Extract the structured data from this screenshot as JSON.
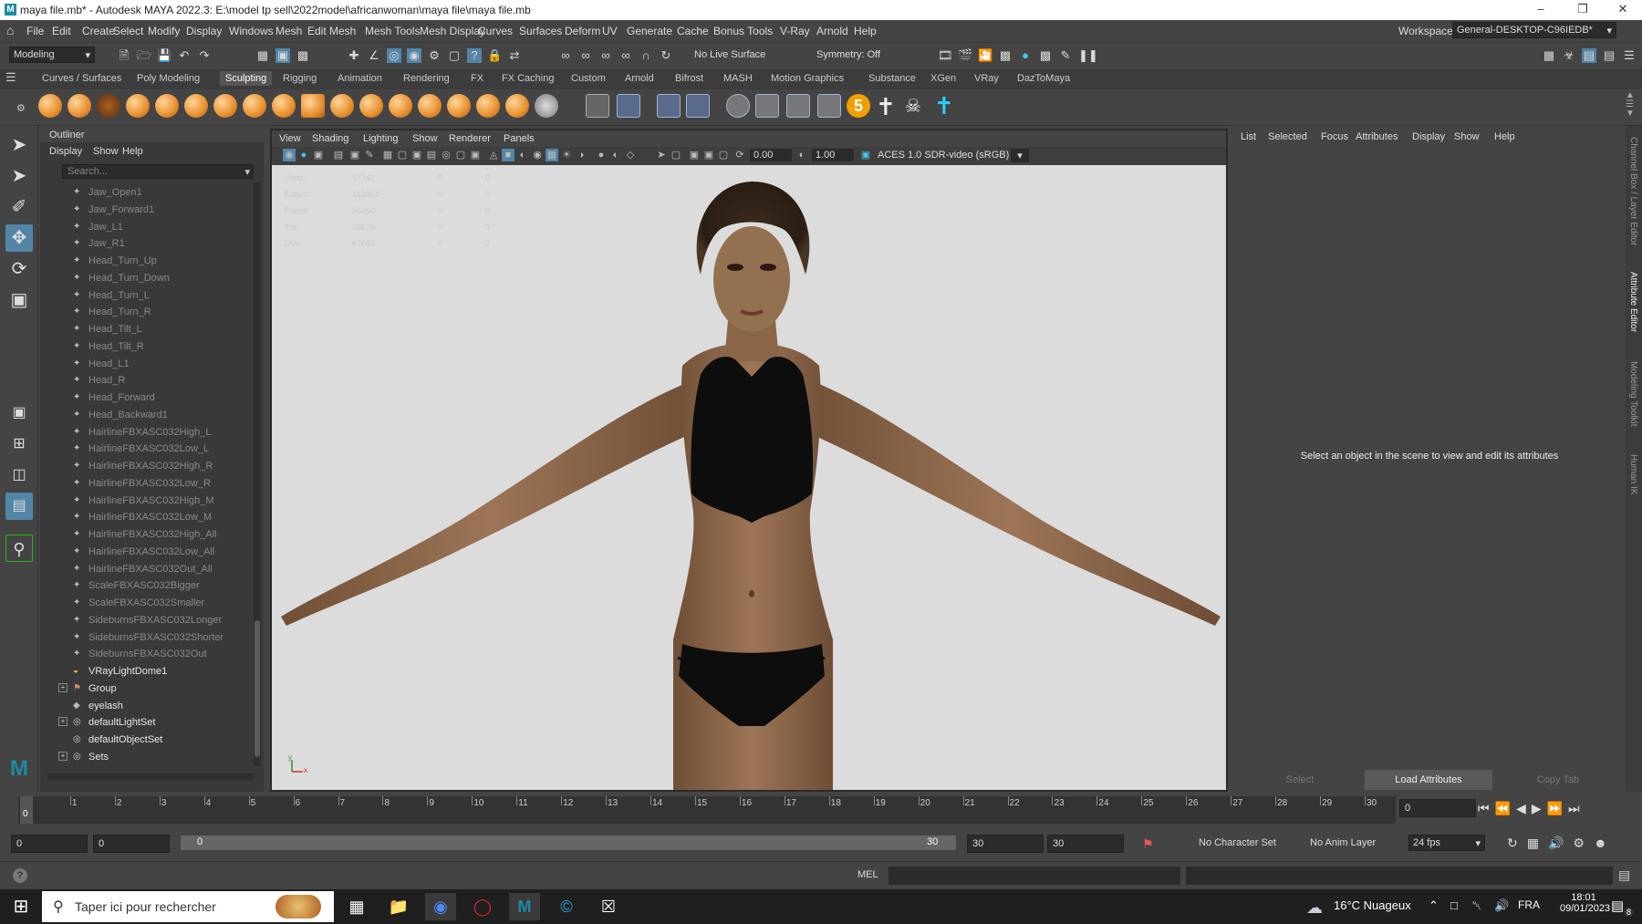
{
  "titlebar": {
    "title": "maya file.mb* - Autodesk MAYA 2022.3: E:\\model tp sell\\2022model\\africanwoman\\maya file\\maya file.mb"
  },
  "menubar": {
    "items": [
      "File",
      "Edit",
      "Create",
      "Select",
      "Modify",
      "Display",
      "Windows",
      "Mesh",
      "Edit Mesh",
      "Mesh Tools",
      "Mesh Display",
      "Curves",
      "Surfaces",
      "Deform",
      "UV",
      "Generate",
      "Cache",
      "Bonus Tools",
      "V-Ray",
      "Arnold",
      "Help"
    ],
    "workspace_label": "Workspace:",
    "workspace_value": "General-DESKTOP-C96IEDB*"
  },
  "statusline": {
    "mode": "Modeling",
    "live_surface": "No Live Surface",
    "symmetry": "Symmetry: Off"
  },
  "shelf_tabs": [
    "Curves / Surfaces",
    "Poly Modeling",
    "Sculpting",
    "Rigging",
    "Animation",
    "Rendering",
    "FX",
    "FX Caching",
    "Custom",
    "Arnold",
    "Bifrost",
    "MASH",
    "Motion Graphics",
    "Substance",
    "XGen",
    "VRay",
    "DazToMaya"
  ],
  "active_shelf_tab": "Sculpting",
  "outliner": {
    "title": "Outliner",
    "menu": [
      "Display",
      "Show",
      "Help"
    ],
    "search_placeholder": "Search...",
    "rows": [
      {
        "label": "Jaw_Open1",
        "icon": "blendshape-icon",
        "bright": false,
        "expand": ""
      },
      {
        "label": "Jaw_Forward1",
        "icon": "blendshape-icon",
        "bright": false,
        "expand": ""
      },
      {
        "label": "Jaw_L1",
        "icon": "blendshape-icon",
        "bright": false,
        "expand": ""
      },
      {
        "label": "Jaw_R1",
        "icon": "blendshape-icon",
        "bright": false,
        "expand": ""
      },
      {
        "label": "Head_Turn_Up",
        "icon": "blendshape-icon",
        "bright": false,
        "expand": ""
      },
      {
        "label": "Head_Turn_Down",
        "icon": "blendshape-icon",
        "bright": false,
        "expand": ""
      },
      {
        "label": "Head_Turn_L",
        "icon": "blendshape-icon",
        "bright": false,
        "expand": ""
      },
      {
        "label": "Head_Turn_R",
        "icon": "blendshape-icon",
        "bright": false,
        "expand": ""
      },
      {
        "label": "Head_Tilt_L",
        "icon": "blendshape-icon",
        "bright": false,
        "expand": ""
      },
      {
        "label": "Head_Tilt_R",
        "icon": "blendshape-icon",
        "bright": false,
        "expand": ""
      },
      {
        "label": "Head_L1",
        "icon": "blendshape-icon",
        "bright": false,
        "expand": ""
      },
      {
        "label": "Head_R",
        "icon": "blendshape-icon",
        "bright": false,
        "expand": ""
      },
      {
        "label": "Head_Forward",
        "icon": "blendshape-icon",
        "bright": false,
        "expand": ""
      },
      {
        "label": "Head_Backward1",
        "icon": "blendshape-icon",
        "bright": false,
        "expand": ""
      },
      {
        "label": "HairlineFBXASC032High_L",
        "icon": "blendshape-icon",
        "bright": false,
        "expand": ""
      },
      {
        "label": "HairlineFBXASC032Low_L",
        "icon": "blendshape-icon",
        "bright": false,
        "expand": ""
      },
      {
        "label": "HairlineFBXASC032High_R",
        "icon": "blendshape-icon",
        "bright": false,
        "expand": ""
      },
      {
        "label": "HairlineFBXASC032Low_R",
        "icon": "blendshape-icon",
        "bright": false,
        "expand": ""
      },
      {
        "label": "HairlineFBXASC032High_M",
        "icon": "blendshape-icon",
        "bright": false,
        "expand": ""
      },
      {
        "label": "HairlineFBXASC032Low_M",
        "icon": "blendshape-icon",
        "bright": false,
        "expand": ""
      },
      {
        "label": "HairlineFBXASC032High_All",
        "icon": "blendshape-icon",
        "bright": false,
        "expand": ""
      },
      {
        "label": "HairlineFBXASC032Low_All",
        "icon": "blendshape-icon",
        "bright": false,
        "expand": ""
      },
      {
        "label": "HairlineFBXASC032Out_All",
        "icon": "blendshape-icon",
        "bright": false,
        "expand": ""
      },
      {
        "label": "ScaleFBXASC032Bigger",
        "icon": "blendshape-icon",
        "bright": false,
        "expand": ""
      },
      {
        "label": "ScaleFBXASC032Smaller",
        "icon": "blendshape-icon",
        "bright": false,
        "expand": ""
      },
      {
        "label": "SideburnsFBXASC032Longer",
        "icon": "blendshape-icon",
        "bright": false,
        "expand": ""
      },
      {
        "label": "SideburnsFBXASC032Shorter",
        "icon": "blendshape-icon",
        "bright": false,
        "expand": ""
      },
      {
        "label": "SideburnsFBXASC032Out",
        "icon": "blendshape-icon",
        "bright": false,
        "expand": ""
      },
      {
        "label": "VRayLightDome1",
        "icon": "dome-light-icon",
        "bright": true,
        "expand": ""
      },
      {
        "label": "Group",
        "icon": "group-icon",
        "bright": true,
        "expand": "+"
      },
      {
        "label": "eyelash",
        "icon": "mesh-icon",
        "bright": true,
        "expand": ""
      },
      {
        "label": "defaultLightSet",
        "icon": "set-icon",
        "bright": true,
        "expand": "+"
      },
      {
        "label": "defaultObjectSet",
        "icon": "set-icon",
        "bright": true,
        "expand": ""
      },
      {
        "label": "Sets",
        "icon": "set-icon",
        "bright": true,
        "expand": "+"
      }
    ]
  },
  "viewport": {
    "menu": [
      "View",
      "Shading",
      "Lighting",
      "Show",
      "Renderer",
      "Panels"
    ],
    "exposure": "0.00",
    "gamma": "1.00",
    "color_space": "ACES 1.0 SDR-video (sRGB)",
    "hud": [
      [
        "Verts:",
        "57742",
        "0",
        "0"
      ],
      [
        "Edges:",
        "112054",
        "0",
        "0"
      ],
      [
        "Faces:",
        "56260",
        "0",
        "0"
      ],
      [
        "Tris:",
        "98676",
        "0",
        "0"
      ],
      [
        "UVs:",
        "67064",
        "0",
        "0"
      ]
    ],
    "axis": {
      "y": "y",
      "x": "x"
    }
  },
  "attribute_editor": {
    "menu": [
      "List",
      "Selected",
      "Focus",
      "Attributes",
      "Display",
      "Show",
      "Help"
    ],
    "message": "Select an object in the scene to view and edit its attributes",
    "buttons": [
      "Select",
      "Load Attributes",
      "Copy Tab"
    ]
  },
  "right_tabs": [
    "Channel Box / Layer Editor",
    "Attribute Editor",
    "Modeling Toolkit",
    "Human IK"
  ],
  "timeslider": {
    "ticks": [
      "0",
      "1",
      "2",
      "3",
      "4",
      "5",
      "6",
      "7",
      "8",
      "9",
      "10",
      "11",
      "12",
      "13",
      "14",
      "15",
      "16",
      "17",
      "18",
      "19",
      "20",
      "21",
      "22",
      "23",
      "24",
      "25",
      "26",
      "27",
      "28",
      "29",
      "30"
    ],
    "current_frame": "0",
    "current_frame_field": "0"
  },
  "range": {
    "start": "0",
    "anim_start": "0",
    "slider_start": "0",
    "slider_end": "30",
    "anim_end": "30",
    "end": "30",
    "character_set": "No Character Set",
    "anim_layer": "No Anim Layer",
    "fps": "24 fps"
  },
  "cmdline": {
    "label": "MEL"
  },
  "taskbar": {
    "search_placeholder": "Taper ici pour rechercher",
    "weather": "16°C Nuageux",
    "lang": "FRA",
    "time": "18:01",
    "date": "09/01/2023",
    "notification_count": "8"
  }
}
